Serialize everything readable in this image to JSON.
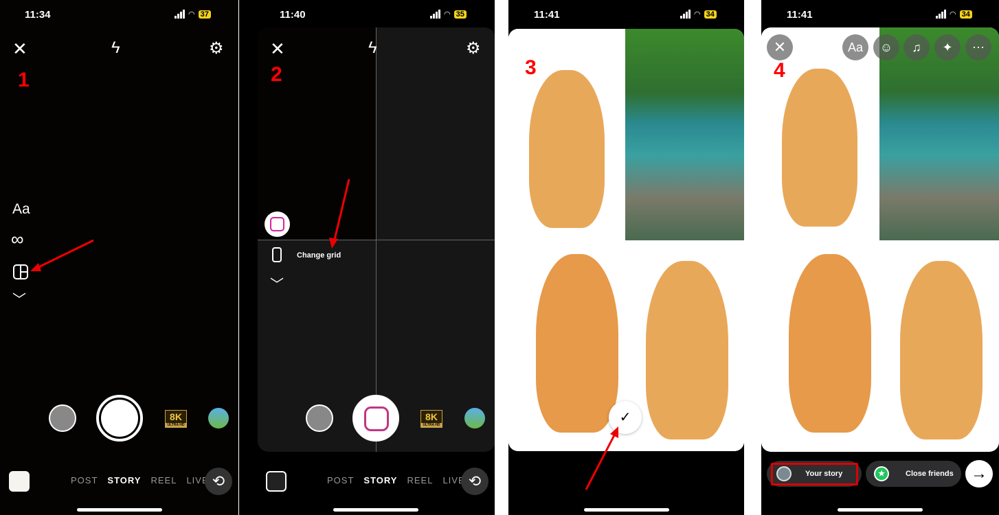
{
  "panels": [
    {
      "step": "1",
      "time": "11:34",
      "battery": "37"
    },
    {
      "step": "2",
      "time": "11:40",
      "battery": "35",
      "change_grid_label": "Change grid"
    },
    {
      "step": "3",
      "time": "11:41",
      "battery": "34"
    },
    {
      "step": "4",
      "time": "11:41",
      "battery": "34"
    }
  ],
  "modes": [
    "POST",
    "STORY",
    "REEL",
    "LIVE"
  ],
  "side_tools": {
    "text": "Aa",
    "boomerang": "∞"
  },
  "eightk": {
    "big": "8K",
    "small": "ULTRA HD"
  },
  "editor": {
    "text_tool": "Aa",
    "your_story": "Your story",
    "close_friends": "Close friends"
  },
  "colors": {
    "annotation": "#ff0000",
    "close_friends": "#22c55e",
    "battery": "#f2d21b"
  }
}
